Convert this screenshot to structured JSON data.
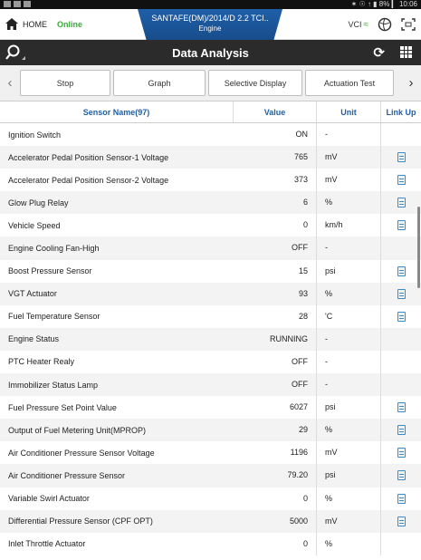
{
  "statusbar": {
    "right": "✶ ☉ ↑ ▮ 8% ▎ 10:06"
  },
  "header": {
    "home_label": "HOME",
    "online_label": "Online",
    "vehicle_name": "SANTAFE(DM)/2014/D 2.2 TCI..",
    "system": "Engine",
    "vci_label": "VCI"
  },
  "titlebar": {
    "title": "Data Analysis"
  },
  "toolbar": {
    "stop": "Stop",
    "graph": "Graph",
    "selective_display": "Selective Display",
    "actuation_test": "Actuation Test"
  },
  "table": {
    "headers": {
      "name": "Sensor Name(97)",
      "value": "Value",
      "unit": "Unit",
      "link": "Link Up"
    },
    "rows": [
      {
        "name": "Ignition Switch",
        "value": "ON",
        "unit": "-",
        "link": false
      },
      {
        "name": "Accelerator Pedal Position Sensor-1 Voltage",
        "value": "765",
        "unit": "mV",
        "link": true
      },
      {
        "name": "Accelerator Pedal Position Sensor-2 Voltage",
        "value": "373",
        "unit": "mV",
        "link": true
      },
      {
        "name": "Glow Plug Relay",
        "value": "6",
        "unit": "%",
        "link": true
      },
      {
        "name": "Vehicle Speed",
        "value": "0",
        "unit": "km/h",
        "link": true
      },
      {
        "name": "Engine Cooling Fan-High",
        "value": "OFF",
        "unit": "-",
        "link": false
      },
      {
        "name": "Boost Pressure Sensor",
        "value": "15",
        "unit": "psi",
        "link": true
      },
      {
        "name": "VGT Actuator",
        "value": "93",
        "unit": "%",
        "link": true
      },
      {
        "name": "Fuel Temperature Sensor",
        "value": "28",
        "unit": "'C",
        "link": true
      },
      {
        "name": "Engine Status",
        "value": "RUNNING",
        "unit": "-",
        "link": false
      },
      {
        "name": "PTC Heater Realy",
        "value": "OFF",
        "unit": "-",
        "link": false
      },
      {
        "name": "Immobilizer Status Lamp",
        "value": "OFF",
        "unit": "-",
        "link": false
      },
      {
        "name": "Fuel Pressure Set Point Value",
        "value": "6027",
        "unit": "psi",
        "link": true
      },
      {
        "name": "Output of Fuel Metering Unit(MPROP)",
        "value": "29",
        "unit": "%",
        "link": true
      },
      {
        "name": "Air Conditioner Pressure Sensor Voltage",
        "value": "1196",
        "unit": "mV",
        "link": true
      },
      {
        "name": "Air Conditioner Pressure Sensor",
        "value": "79.20",
        "unit": "psi",
        "link": true
      },
      {
        "name": "Variable Swirl Actuator",
        "value": "0",
        "unit": "%",
        "link": true
      },
      {
        "name": "Differential Pressure Sensor (CPF OPT)",
        "value": "5000",
        "unit": "mV",
        "link": true
      },
      {
        "name": "Inlet Throttle Actuator",
        "value": "0",
        "unit": "%",
        "link": false
      }
    ]
  }
}
